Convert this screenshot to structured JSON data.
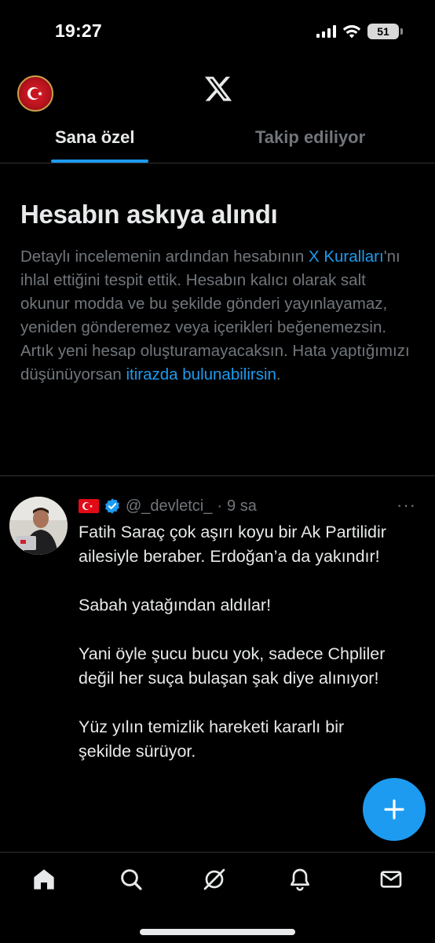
{
  "status_bar": {
    "time": "19:27",
    "battery": "51"
  },
  "header": {
    "logo_icon": "x-logo-icon",
    "avatar_icon": "turkish-flag-avatar"
  },
  "tabs": [
    {
      "label": "Sana özel",
      "active": true
    },
    {
      "label": "Takip ediliyor",
      "active": false
    }
  ],
  "notice": {
    "title": "Hesabın askıya alındı",
    "body_part1": "Detaylı incelemenin ardından hesabının ",
    "rules_link": "X Kuralları",
    "body_part2": "'nı ihlal ettiğini tespit ettik. Hesabın kalıcı olarak salt okunur modda ve bu şekilde gönderi yayınlayamaz, yeniden gönderemez veya içerikleri beğenemezsin. Artık yeni hesap oluşturamayacaksın. Hata yaptığımızı düşünüyorsan ",
    "appeal_link": "itirazda bulunabilirsin",
    "body_end": "."
  },
  "post": {
    "handle": "@_devletci_",
    "separator": "·",
    "time": "9 sa",
    "more": "···",
    "text": "Fatih Saraç çok aşırı koyu bir Ak Partilidir ailesiyle beraber. Erdoğan’a da yakındır!\n\nSabah yatağından aldılar!\n\nYani öyle şucu bucu yok, sadece Chpliler değil her suça bulaşan şak diye alınıyor!\n\nYüz yılın temizlik hareketi kararlı bir şekilde sürüyor."
  },
  "fab": {
    "icon": "plus-icon"
  },
  "bottom_nav": [
    "home-icon",
    "search-icon",
    "grok-icon",
    "notifications-icon",
    "messages-icon"
  ],
  "colors": {
    "accent": "#1d9bf0",
    "muted": "#71767b",
    "text": "#e7e9ea",
    "background": "#000000"
  }
}
